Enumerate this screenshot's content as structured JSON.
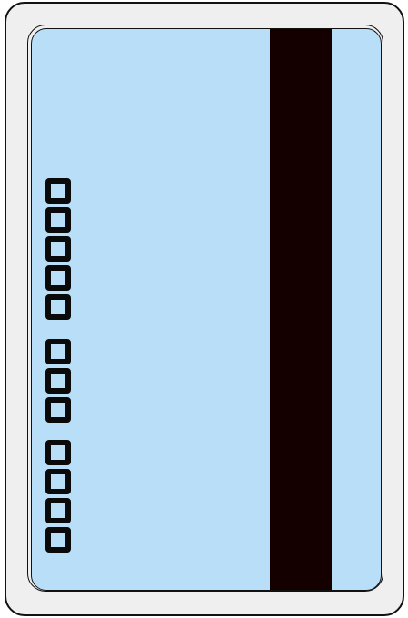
{
  "card": {
    "colors": {
      "body": "#efefef",
      "face": "#b9dff8",
      "stripe": "#150000",
      "outline": "#111111"
    },
    "chip_groups": [
      5,
      3,
      4
    ]
  }
}
